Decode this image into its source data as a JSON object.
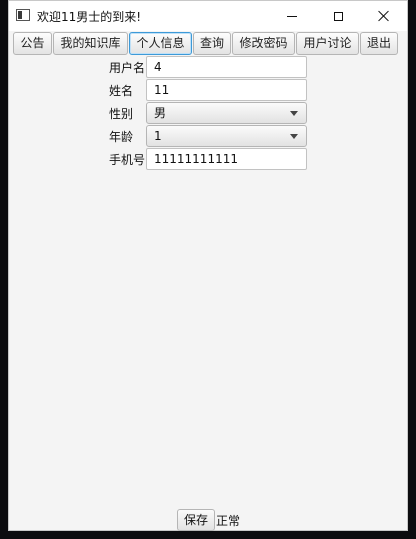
{
  "window": {
    "title": "欢迎11男士的到来!"
  },
  "tabs": [
    {
      "label": "公告"
    },
    {
      "label": "我的知识库"
    },
    {
      "label": "个人信息"
    },
    {
      "label": "查询"
    },
    {
      "label": "修改密码"
    },
    {
      "label": "用户讨论"
    },
    {
      "label": "退出"
    }
  ],
  "active_tab": "个人信息",
  "form": {
    "username": {
      "label": "用户名",
      "value": "4"
    },
    "name": {
      "label": "姓名",
      "value": "11"
    },
    "gender": {
      "label": "性别",
      "value": "男"
    },
    "age": {
      "label": "年龄",
      "value": "1"
    },
    "phone": {
      "label": "手机号",
      "value": "11111111111"
    }
  },
  "footer": {
    "save_label": "保存",
    "status": "正常"
  },
  "icons": {
    "app": "app-window-icon",
    "minimize": "minimize-icon",
    "maximize": "maximize-icon",
    "close": "close-icon"
  },
  "colors": {
    "window_bg": "#f4f4f4",
    "active_tab_border": "#3d9ad8",
    "desktop_bg": "#0c0c0f"
  }
}
